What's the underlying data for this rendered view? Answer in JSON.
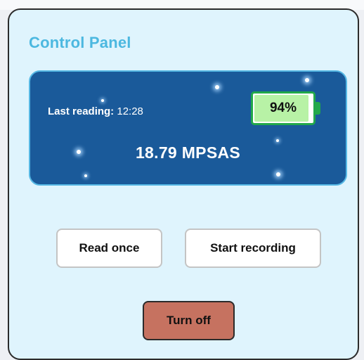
{
  "panel": {
    "title": "Control Panel"
  },
  "reading": {
    "last_label": "Last reading:",
    "last_time": "12:28",
    "value": "18.79 MPSAS"
  },
  "battery": {
    "percent_text": "94%",
    "level": 0.94,
    "color": "#22a84a"
  },
  "buttons": {
    "read_once": "Read once",
    "start_recording": "Start recording",
    "turn_off": "Turn off"
  },
  "colors": {
    "accent": "#4cb8e0",
    "card_bg": "#1a5a9a",
    "panel_bg": "#dff4fd",
    "turn_off_bg": "#c67260"
  }
}
